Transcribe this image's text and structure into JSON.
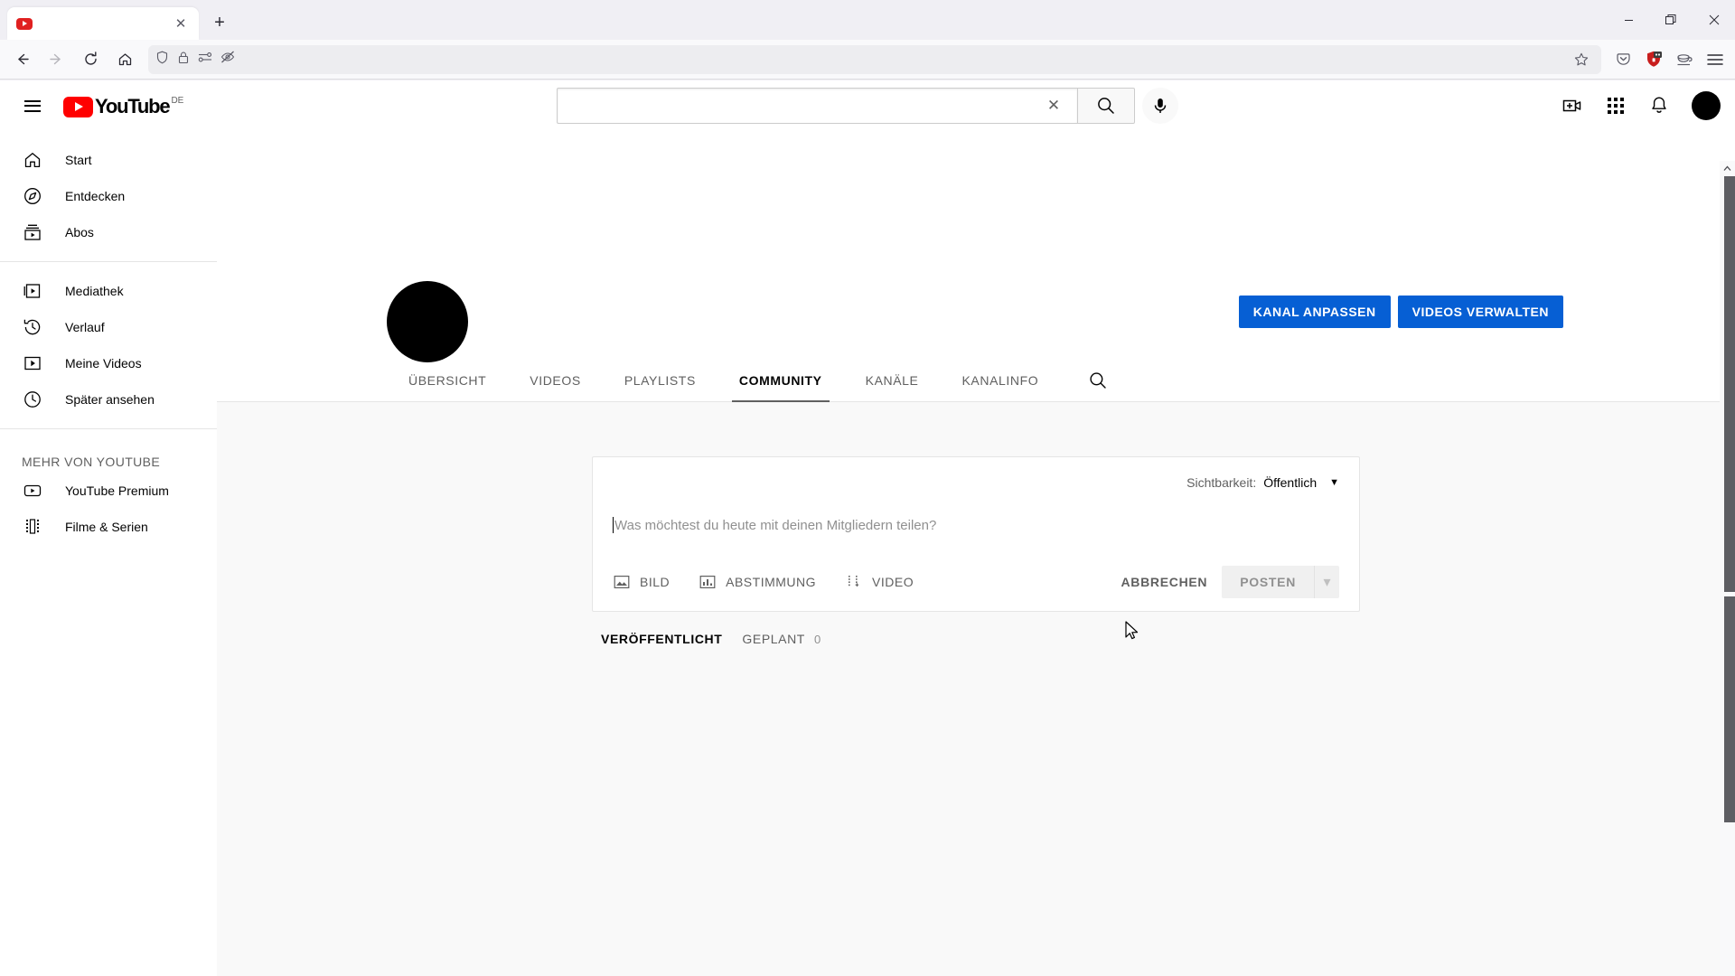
{
  "browser": {
    "tab": {
      "title": "",
      "favicon": "youtube-favicon",
      "close_label": "✕"
    },
    "new_tab_label": "+",
    "window_controls": {
      "minimize": "—",
      "restore": "❐",
      "close": "✕"
    },
    "nav": {
      "back": "←",
      "forward": "→",
      "reload": "⟳",
      "home": "⌂"
    },
    "url": {
      "value": "",
      "placeholder": ""
    },
    "url_icons": [
      "shield-icon",
      "lock-icon",
      "permissions-icon",
      "blocked-icon"
    ],
    "bookmark_star": "☆",
    "toolbar_icons": [
      "pocket-icon",
      "ublock-origin-icon",
      "coffee-extension-icon",
      "app-menu-icon"
    ]
  },
  "header": {
    "menu_label": "Guide",
    "logo_text": "YouTube",
    "logo_country": "DE",
    "search": {
      "value": "",
      "placeholder": ""
    },
    "clear_label": "✕",
    "search_button_label": "Suchen",
    "mic_label": "Mit der Stimme suchen",
    "create_label": "Erstellen",
    "apps_label": "YouTube-Apps",
    "notifications_label": "Benachrichtigungen",
    "avatar_label": "Konto"
  },
  "sidebar": {
    "primary": [
      {
        "label": "Start",
        "icon": "home-icon"
      },
      {
        "label": "Entdecken",
        "icon": "compass-icon"
      },
      {
        "label": "Abos",
        "icon": "subscriptions-icon"
      }
    ],
    "secondary": [
      {
        "label": "Mediathek",
        "icon": "library-icon"
      },
      {
        "label": "Verlauf",
        "icon": "history-icon"
      },
      {
        "label": "Meine Videos",
        "icon": "my-videos-icon"
      },
      {
        "label": "Später ansehen",
        "icon": "clock-icon"
      }
    ],
    "more_title": "MEHR VON YOUTUBE",
    "more": [
      {
        "label": "YouTube Premium",
        "icon": "premium-icon"
      },
      {
        "label": "Filme & Serien",
        "icon": "film-icon"
      }
    ]
  },
  "channel": {
    "avatar_label": "Kanalbild",
    "buttons": [
      {
        "label": "KANAL ANPASSEN",
        "name": "customize-channel-button"
      },
      {
        "label": "VIDEOS VERWALTEN",
        "name": "manage-videos-button"
      }
    ],
    "tabs": [
      {
        "label": "ÜBERSICHT",
        "active": false
      },
      {
        "label": "VIDEOS",
        "active": false
      },
      {
        "label": "PLAYLISTS",
        "active": false
      },
      {
        "label": "COMMUNITY",
        "active": true
      },
      {
        "label": "KANÄLE",
        "active": false
      },
      {
        "label": "KANALINFO",
        "active": false
      }
    ],
    "search_icon_label": "Kanal durchsuchen"
  },
  "composer": {
    "visibility_label": "Sichtbarkeit:",
    "visibility_value": "Öffentlich",
    "visibility_caret": "▼",
    "placeholder": "Was möchtest du heute mit deinen Mitgliedern teilen?",
    "actions": [
      {
        "label": "BILD",
        "icon": "image-icon"
      },
      {
        "label": "ABSTIMMUNG",
        "icon": "poll-icon"
      },
      {
        "label": "VIDEO",
        "icon": "video-icon"
      }
    ],
    "cancel_label": "ABBRECHEN",
    "post_label": "POSTEN",
    "post_arrow": "▾"
  },
  "post_tabs": [
    {
      "label": "VERÖFFENTLICHT",
      "count": "",
      "active": true
    },
    {
      "label": "GEPLANT",
      "count": "0",
      "active": false
    }
  ],
  "colors": {
    "accent_blue": "#065fd4",
    "youtube_red": "#ff0000",
    "text_primary": "#030303",
    "text_secondary": "#606060",
    "page_bg": "#f9f9f9"
  }
}
